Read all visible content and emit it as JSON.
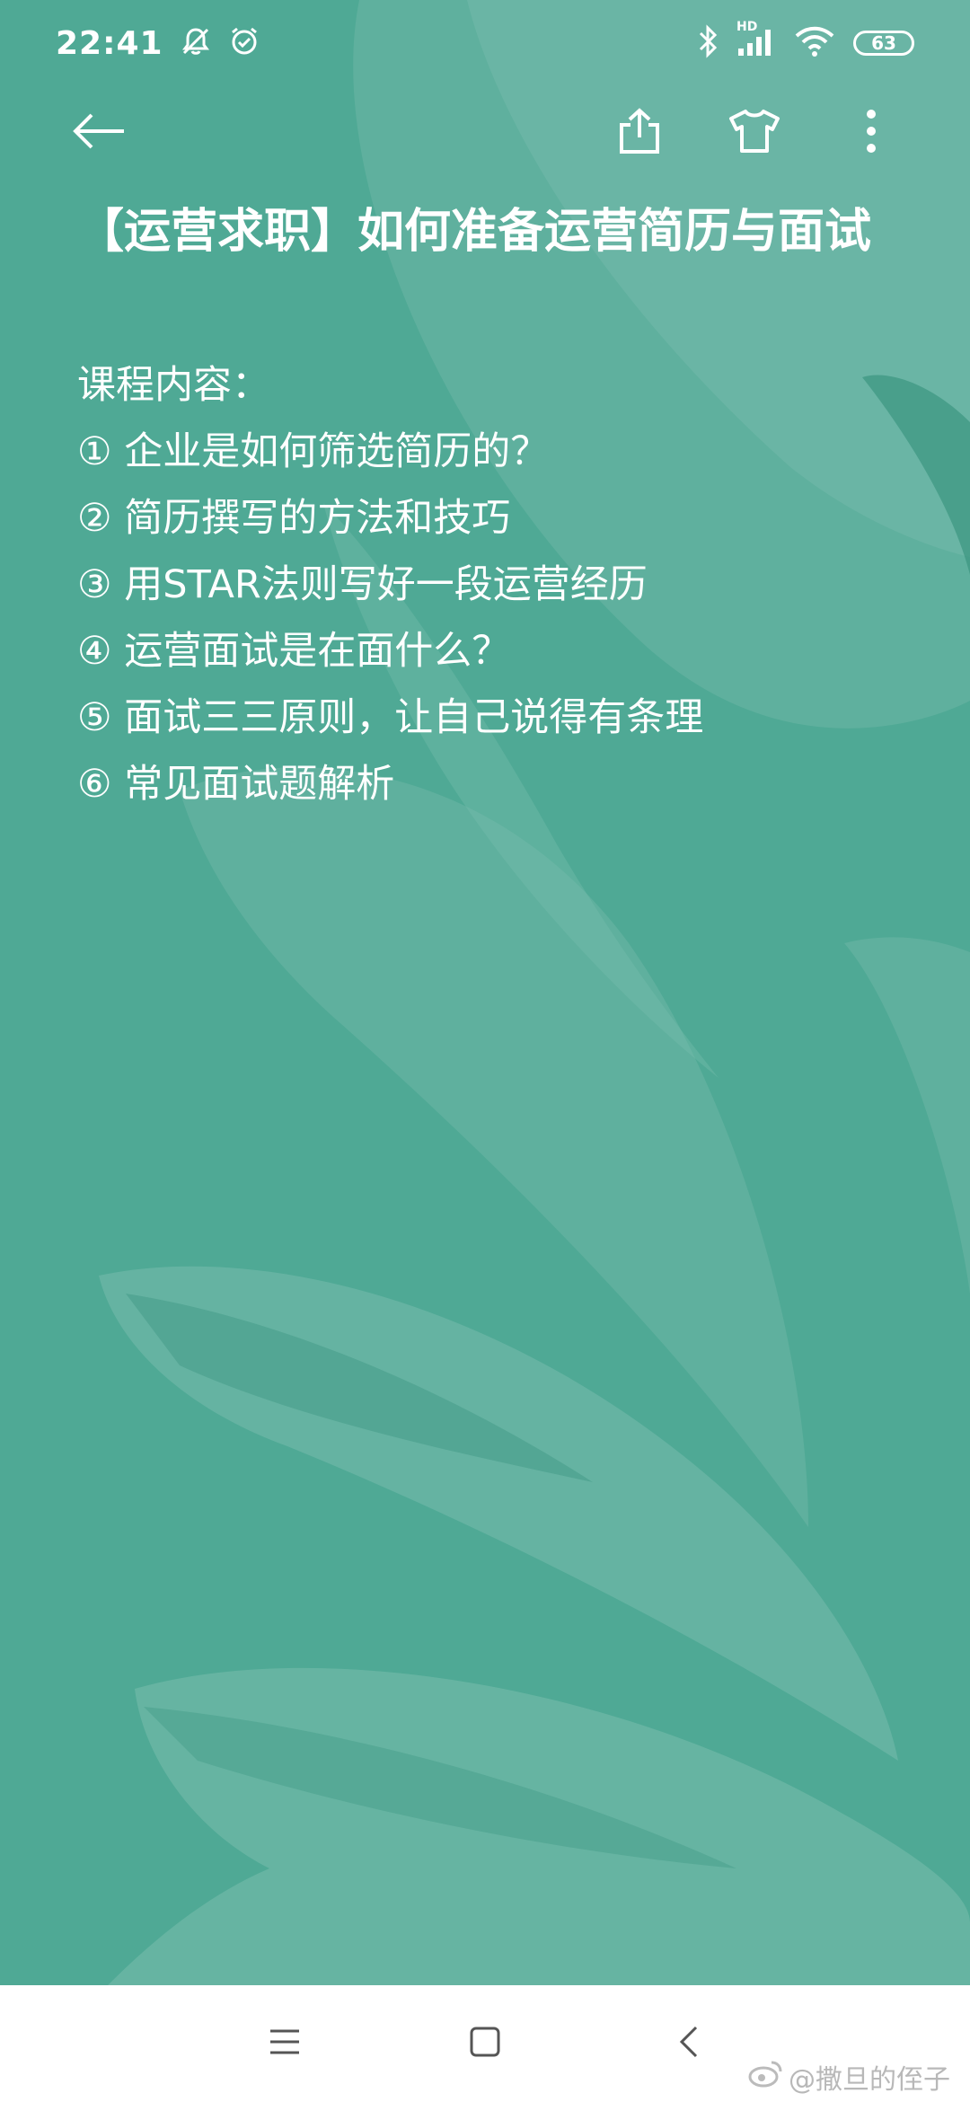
{
  "status_bar": {
    "time": "22:41",
    "network_label": "HD",
    "battery": "63"
  },
  "toolbar": {
    "back_icon": "arrow-left-icon",
    "share_icon": "share-icon",
    "theme_icon": "tshirt-icon",
    "more_icon": "more-vertical-icon"
  },
  "note": {
    "title": "【运营求职】如何准备运营简历与面试",
    "heading": "课程内容：",
    "items": [
      "① 企业是如何筛选简历的？",
      "② 简历撰写的方法和技巧",
      "③ 用STAR法则写好一段运营经历",
      "④ 运营面试是在面什么？",
      "⑤ 面试三三原则，让自己说得有条理",
      "⑥ 常见面试题解析"
    ]
  },
  "colors": {
    "background": "#4fa995",
    "leaf_light": "#72baa9",
    "leaf_dark": "#3d9682",
    "navbar": "#ffffff"
  },
  "watermark": "@撒旦的侄子"
}
